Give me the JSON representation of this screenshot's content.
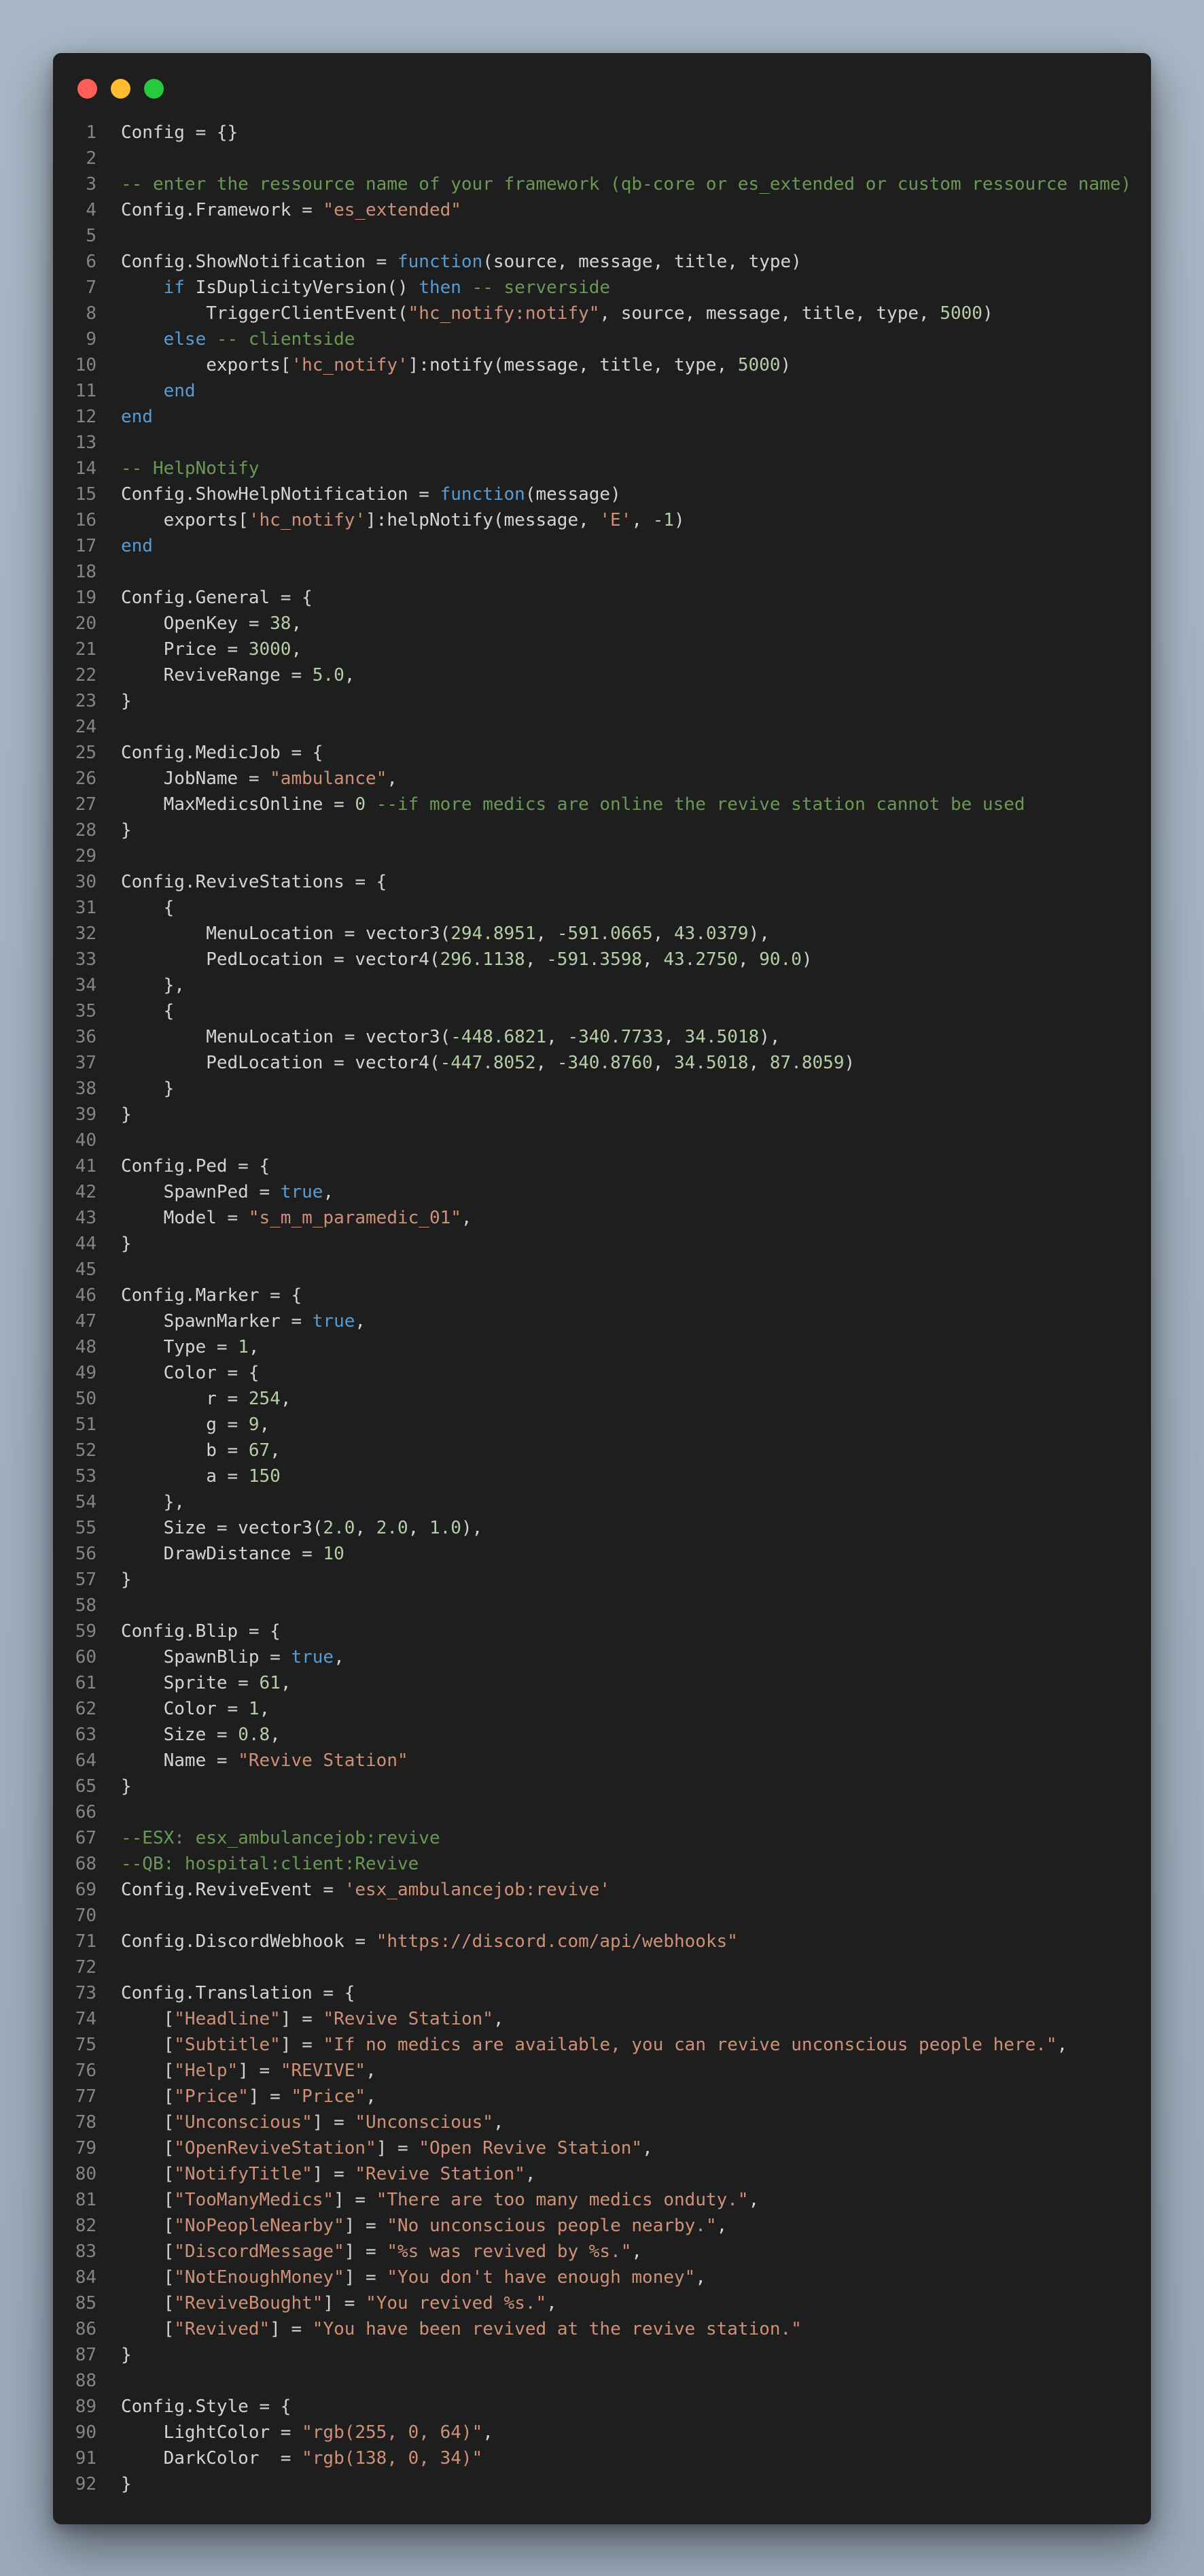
{
  "colors": {
    "window_bg": "#1e1e1e",
    "close": "#ff5f57",
    "minimize": "#febc2e",
    "zoom": "#28c840",
    "line_number": "#858585",
    "plain": "#d4d4d4",
    "keyword": "#569cd6",
    "string": "#ce9178",
    "number": "#b5cea8",
    "comment": "#6a9955"
  },
  "window_controls": [
    "close-icon",
    "minimize-icon",
    "zoom-icon"
  ],
  "lines": [
    [
      [
        "Config = {}",
        "plain"
      ]
    ],
    [],
    [
      [
        "-- enter the ressource name of your framework (qb-core or es_extended or custom ressource name)",
        "com"
      ]
    ],
    [
      [
        "Config.Framework = ",
        "plain"
      ],
      [
        "\"es_extended\"",
        "str"
      ]
    ],
    [],
    [
      [
        "Config.ShowNotification = ",
        "plain"
      ],
      [
        "function",
        "kw"
      ],
      [
        "(source, message, title, type)",
        "plain"
      ]
    ],
    [
      [
        "    ",
        "plain"
      ],
      [
        "if",
        "kw"
      ],
      [
        " IsDuplicityVersion() ",
        "plain"
      ],
      [
        "then",
        "kw"
      ],
      [
        " -- serverside",
        "com"
      ]
    ],
    [
      [
        "        TriggerClientEvent(",
        "plain"
      ],
      [
        "\"hc_notify:notify\"",
        "str"
      ],
      [
        ", source, message, title, type, ",
        "plain"
      ],
      [
        "5000",
        "num"
      ],
      [
        ")",
        "plain"
      ]
    ],
    [
      [
        "    ",
        "plain"
      ],
      [
        "else",
        "kw"
      ],
      [
        " -- clientside",
        "com"
      ]
    ],
    [
      [
        "        exports[",
        "plain"
      ],
      [
        "'hc_notify'",
        "str"
      ],
      [
        "]:notify(message, title, type, ",
        "plain"
      ],
      [
        "5000",
        "num"
      ],
      [
        ")",
        "plain"
      ]
    ],
    [
      [
        "    ",
        "plain"
      ],
      [
        "end",
        "kw"
      ]
    ],
    [
      [
        "end",
        "kw"
      ]
    ],
    [],
    [
      [
        "-- HelpNotify",
        "com"
      ]
    ],
    [
      [
        "Config.ShowHelpNotification = ",
        "plain"
      ],
      [
        "function",
        "kw"
      ],
      [
        "(message)",
        "plain"
      ]
    ],
    [
      [
        "    exports[",
        "plain"
      ],
      [
        "'hc_notify'",
        "str"
      ],
      [
        "]:helpNotify(message, ",
        "plain"
      ],
      [
        "'E'",
        "str"
      ],
      [
        ", ",
        "plain"
      ],
      [
        "-1",
        "num"
      ],
      [
        ")",
        "plain"
      ]
    ],
    [
      [
        "end",
        "kw"
      ]
    ],
    [],
    [
      [
        "Config.General = {",
        "plain"
      ]
    ],
    [
      [
        "    OpenKey = ",
        "plain"
      ],
      [
        "38",
        "num"
      ],
      [
        ",",
        "plain"
      ]
    ],
    [
      [
        "    Price = ",
        "plain"
      ],
      [
        "3000",
        "num"
      ],
      [
        ",",
        "plain"
      ]
    ],
    [
      [
        "    ReviveRange = ",
        "plain"
      ],
      [
        "5.0",
        "num"
      ],
      [
        ",",
        "plain"
      ]
    ],
    [
      [
        "}",
        "plain"
      ]
    ],
    [],
    [
      [
        "Config.MedicJob = {",
        "plain"
      ]
    ],
    [
      [
        "    JobName = ",
        "plain"
      ],
      [
        "\"ambulance\"",
        "str"
      ],
      [
        ",",
        "plain"
      ]
    ],
    [
      [
        "    MaxMedicsOnline = ",
        "plain"
      ],
      [
        "0",
        "num"
      ],
      [
        " --if more medics are online the revive station cannot be used",
        "com"
      ]
    ],
    [
      [
        "}",
        "plain"
      ]
    ],
    [],
    [
      [
        "Config.ReviveStations = {",
        "plain"
      ]
    ],
    [
      [
        "    {",
        "plain"
      ]
    ],
    [
      [
        "        MenuLocation = vector3(",
        "plain"
      ],
      [
        "294.8951",
        "num"
      ],
      [
        ", ",
        "plain"
      ],
      [
        "-591.0665",
        "num"
      ],
      [
        ", ",
        "plain"
      ],
      [
        "43.0379",
        "num"
      ],
      [
        "),",
        "plain"
      ]
    ],
    [
      [
        "        PedLocation = vector4(",
        "plain"
      ],
      [
        "296.1138",
        "num"
      ],
      [
        ", ",
        "plain"
      ],
      [
        "-591.3598",
        "num"
      ],
      [
        ", ",
        "plain"
      ],
      [
        "43.2750",
        "num"
      ],
      [
        ", ",
        "plain"
      ],
      [
        "90.0",
        "num"
      ],
      [
        ")",
        "plain"
      ]
    ],
    [
      [
        "    },",
        "plain"
      ]
    ],
    [
      [
        "    {",
        "plain"
      ]
    ],
    [
      [
        "        MenuLocation = vector3(",
        "plain"
      ],
      [
        "-448.6821",
        "num"
      ],
      [
        ", ",
        "plain"
      ],
      [
        "-340.7733",
        "num"
      ],
      [
        ", ",
        "plain"
      ],
      [
        "34.5018",
        "num"
      ],
      [
        "),",
        "plain"
      ]
    ],
    [
      [
        "        PedLocation = vector4(",
        "plain"
      ],
      [
        "-447.8052",
        "num"
      ],
      [
        ", ",
        "plain"
      ],
      [
        "-340.8760",
        "num"
      ],
      [
        ", ",
        "plain"
      ],
      [
        "34.5018",
        "num"
      ],
      [
        ", ",
        "plain"
      ],
      [
        "87.8059",
        "num"
      ],
      [
        ")",
        "plain"
      ]
    ],
    [
      [
        "    }",
        "plain"
      ]
    ],
    [
      [
        "}",
        "plain"
      ]
    ],
    [],
    [
      [
        "Config.Ped = {",
        "plain"
      ]
    ],
    [
      [
        "    SpawnPed = ",
        "plain"
      ],
      [
        "true",
        "kw"
      ],
      [
        ",",
        "plain"
      ]
    ],
    [
      [
        "    Model = ",
        "plain"
      ],
      [
        "\"s_m_m_paramedic_01\"",
        "str"
      ],
      [
        ",",
        "plain"
      ]
    ],
    [
      [
        "}",
        "plain"
      ]
    ],
    [],
    [
      [
        "Config.Marker = {",
        "plain"
      ]
    ],
    [
      [
        "    SpawnMarker = ",
        "plain"
      ],
      [
        "true",
        "kw"
      ],
      [
        ",",
        "plain"
      ]
    ],
    [
      [
        "    Type = ",
        "plain"
      ],
      [
        "1",
        "num"
      ],
      [
        ",",
        "plain"
      ]
    ],
    [
      [
        "    Color = {",
        "plain"
      ]
    ],
    [
      [
        "        r = ",
        "plain"
      ],
      [
        "254",
        "num"
      ],
      [
        ",",
        "plain"
      ]
    ],
    [
      [
        "        g = ",
        "plain"
      ],
      [
        "9",
        "num"
      ],
      [
        ",",
        "plain"
      ]
    ],
    [
      [
        "        b = ",
        "plain"
      ],
      [
        "67",
        "num"
      ],
      [
        ",",
        "plain"
      ]
    ],
    [
      [
        "        a = ",
        "plain"
      ],
      [
        "150",
        "num"
      ]
    ],
    [
      [
        "    },",
        "plain"
      ]
    ],
    [
      [
        "    Size = vector3(",
        "plain"
      ],
      [
        "2.0",
        "num"
      ],
      [
        ", ",
        "plain"
      ],
      [
        "2.0",
        "num"
      ],
      [
        ", ",
        "plain"
      ],
      [
        "1.0",
        "num"
      ],
      [
        "),",
        "plain"
      ]
    ],
    [
      [
        "    DrawDistance = ",
        "plain"
      ],
      [
        "10",
        "num"
      ]
    ],
    [
      [
        "}",
        "plain"
      ]
    ],
    [],
    [
      [
        "Config.Blip = {",
        "plain"
      ]
    ],
    [
      [
        "    SpawnBlip = ",
        "plain"
      ],
      [
        "true",
        "kw"
      ],
      [
        ",",
        "plain"
      ]
    ],
    [
      [
        "    Sprite = ",
        "plain"
      ],
      [
        "61",
        "num"
      ],
      [
        ",",
        "plain"
      ]
    ],
    [
      [
        "    Color = ",
        "plain"
      ],
      [
        "1",
        "num"
      ],
      [
        ",",
        "plain"
      ]
    ],
    [
      [
        "    Size = ",
        "plain"
      ],
      [
        "0.8",
        "num"
      ],
      [
        ",",
        "plain"
      ]
    ],
    [
      [
        "    Name = ",
        "plain"
      ],
      [
        "\"Revive Station\"",
        "str"
      ]
    ],
    [
      [
        "}",
        "plain"
      ]
    ],
    [],
    [
      [
        "--ESX: esx_ambulancejob:revive",
        "com"
      ]
    ],
    [
      [
        "--QB: hospital:client:Revive",
        "com"
      ]
    ],
    [
      [
        "Config.ReviveEvent = ",
        "plain"
      ],
      [
        "'esx_ambulancejob:revive'",
        "str"
      ]
    ],
    [],
    [
      [
        "Config.DiscordWebhook = ",
        "plain"
      ],
      [
        "\"https://discord.com/api/webhooks\"",
        "str"
      ]
    ],
    [],
    [
      [
        "Config.Translation = {",
        "plain"
      ]
    ],
    [
      [
        "    [",
        "plain"
      ],
      [
        "\"Headline\"",
        "str"
      ],
      [
        "] = ",
        "plain"
      ],
      [
        "\"Revive Station\"",
        "str"
      ],
      [
        ",",
        "plain"
      ]
    ],
    [
      [
        "    [",
        "plain"
      ],
      [
        "\"Subtitle\"",
        "str"
      ],
      [
        "] = ",
        "plain"
      ],
      [
        "\"If no medics are available, you can revive unconscious people here.\"",
        "str"
      ],
      [
        ",",
        "plain"
      ]
    ],
    [
      [
        "    [",
        "plain"
      ],
      [
        "\"Help\"",
        "str"
      ],
      [
        "] = ",
        "plain"
      ],
      [
        "\"REVIVE\"",
        "str"
      ],
      [
        ",",
        "plain"
      ]
    ],
    [
      [
        "    [",
        "plain"
      ],
      [
        "\"Price\"",
        "str"
      ],
      [
        "] = ",
        "plain"
      ],
      [
        "\"Price\"",
        "str"
      ],
      [
        ",",
        "plain"
      ]
    ],
    [
      [
        "    [",
        "plain"
      ],
      [
        "\"Unconscious\"",
        "str"
      ],
      [
        "] = ",
        "plain"
      ],
      [
        "\"Unconscious\"",
        "str"
      ],
      [
        ",",
        "plain"
      ]
    ],
    [
      [
        "    [",
        "plain"
      ],
      [
        "\"OpenReviveStation\"",
        "str"
      ],
      [
        "] = ",
        "plain"
      ],
      [
        "\"Open Revive Station\"",
        "str"
      ],
      [
        ",",
        "plain"
      ]
    ],
    [
      [
        "    [",
        "plain"
      ],
      [
        "\"NotifyTitle\"",
        "str"
      ],
      [
        "] = ",
        "plain"
      ],
      [
        "\"Revive Station\"",
        "str"
      ],
      [
        ",",
        "plain"
      ]
    ],
    [
      [
        "    [",
        "plain"
      ],
      [
        "\"TooManyMedics\"",
        "str"
      ],
      [
        "] = ",
        "plain"
      ],
      [
        "\"There are too many medics onduty.\"",
        "str"
      ],
      [
        ",",
        "plain"
      ]
    ],
    [
      [
        "    [",
        "plain"
      ],
      [
        "\"NoPeopleNearby\"",
        "str"
      ],
      [
        "] = ",
        "plain"
      ],
      [
        "\"No unconscious people nearby.\"",
        "str"
      ],
      [
        ",",
        "plain"
      ]
    ],
    [
      [
        "    [",
        "plain"
      ],
      [
        "\"DiscordMessage\"",
        "str"
      ],
      [
        "] = ",
        "plain"
      ],
      [
        "\"%s was revived by %s.\"",
        "str"
      ],
      [
        ",",
        "plain"
      ]
    ],
    [
      [
        "    [",
        "plain"
      ],
      [
        "\"NotEnoughMoney\"",
        "str"
      ],
      [
        "] = ",
        "plain"
      ],
      [
        "\"You don't have enough money\"",
        "str"
      ],
      [
        ",",
        "plain"
      ]
    ],
    [
      [
        "    [",
        "plain"
      ],
      [
        "\"ReviveBought\"",
        "str"
      ],
      [
        "] = ",
        "plain"
      ],
      [
        "\"You revived %s.\"",
        "str"
      ],
      [
        ",",
        "plain"
      ]
    ],
    [
      [
        "    [",
        "plain"
      ],
      [
        "\"Revived\"",
        "str"
      ],
      [
        "] = ",
        "plain"
      ],
      [
        "\"You have been revived at the revive station.\"",
        "str"
      ]
    ],
    [
      [
        "}",
        "plain"
      ]
    ],
    [],
    [
      [
        "Config.Style = {",
        "plain"
      ]
    ],
    [
      [
        "    LightColor = ",
        "plain"
      ],
      [
        "\"rgb(255, 0, 64)\"",
        "str"
      ],
      [
        ",",
        "plain"
      ]
    ],
    [
      [
        "    DarkColor  = ",
        "plain"
      ],
      [
        "\"rgb(138, 0, 34)\"",
        "str"
      ]
    ],
    [
      [
        "}",
        "plain"
      ]
    ]
  ]
}
